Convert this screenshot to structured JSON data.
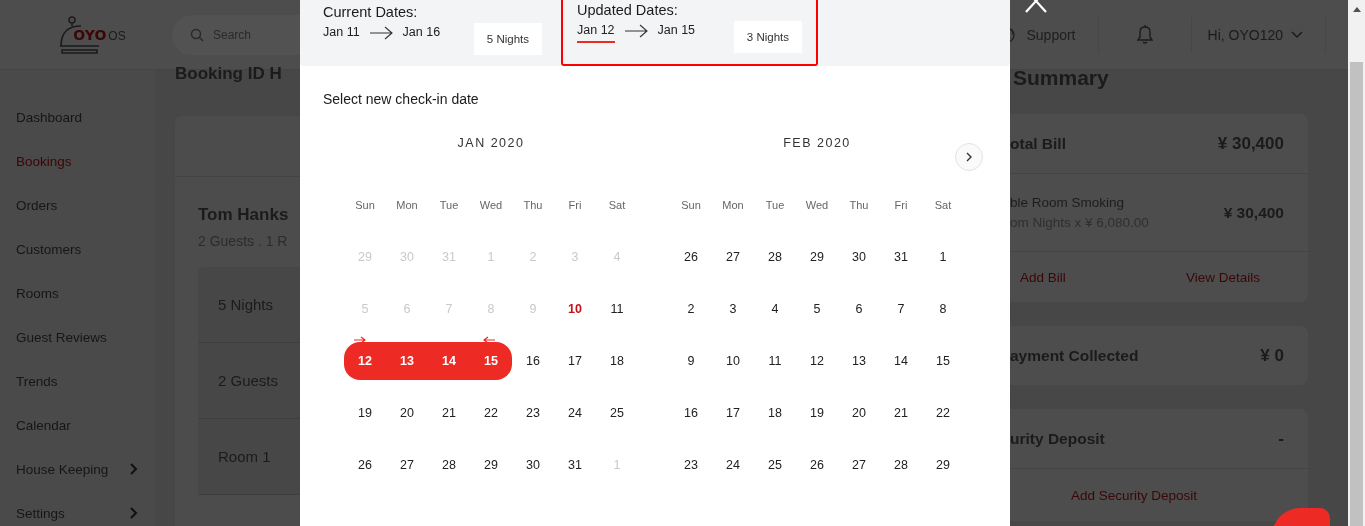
{
  "header": {
    "logo": {
      "brand": "OYO",
      "suffix": "OS"
    },
    "search": {
      "placeholder": "Search"
    },
    "support": "Support",
    "user": "Hi, OYO120"
  },
  "sidebar": {
    "items": [
      {
        "label": "Dashboard",
        "selected": false,
        "expandable": false
      },
      {
        "label": "Bookings",
        "selected": true,
        "expandable": false
      },
      {
        "label": "Orders",
        "selected": false,
        "expandable": false
      },
      {
        "label": "Customers",
        "selected": false,
        "expandable": false
      },
      {
        "label": "Rooms",
        "selected": false,
        "expandable": false
      },
      {
        "label": "Guest Reviews",
        "selected": false,
        "expandable": false
      },
      {
        "label": "Trends",
        "selected": false,
        "expandable": false
      },
      {
        "label": "Calendar",
        "selected": false,
        "expandable": false
      },
      {
        "label": "House Keeping",
        "selected": false,
        "expandable": true
      },
      {
        "label": "Settings",
        "selected": false,
        "expandable": true
      }
    ]
  },
  "booking": {
    "title": "Booking ID H",
    "guest_name": "Tom Hanks",
    "guest_summary": "2 Guests . 1 R",
    "details": [
      "5 Nights",
      "2 Guests",
      "Room 1"
    ]
  },
  "summary": {
    "title": "Summary",
    "total_label": "otal Bill",
    "total_value": "¥ 30,400",
    "item_name": "ble Room Smoking",
    "item_detail": "om Nights x ¥ 6,080.00",
    "item_value": "¥ 30,400",
    "links": [
      "Add Bill",
      "View Details"
    ],
    "payment_label": "ayment Collected",
    "payment_value": "¥ 0",
    "deposit_label": "urity Deposit",
    "deposit_value": "-",
    "deposit_link": "Add Security Deposit"
  },
  "modal": {
    "current": {
      "title": "Current Dates:",
      "from": {
        "text": "Jan 11",
        "selected": false
      },
      "to": {
        "text": "Jan 16",
        "selected": false
      },
      "nights": "5 Nights",
      "highlighted": false
    },
    "updated": {
      "title": "Updated Dates:",
      "from": {
        "text": "Jan 12",
        "selected": true
      },
      "to": {
        "text": "Jan 15",
        "selected": false
      },
      "nights": "3 Nights",
      "highlighted": true
    },
    "prompt": "Select new check-in date",
    "months": [
      {
        "title": "JAN 2020",
        "weekdays": [
          "Sun",
          "Mon",
          "Tue",
          "Wed",
          "Thu",
          "Fri",
          "Sat"
        ],
        "weeks": [
          [
            {
              "day": "29",
              "kind": "disabled",
              "selected": false
            },
            {
              "day": "30",
              "kind": "disabled",
              "selected": false
            },
            {
              "day": "31",
              "kind": "disabled",
              "selected": false
            },
            {
              "day": "1",
              "kind": "disabled",
              "selected": false
            },
            {
              "day": "2",
              "kind": "disabled",
              "selected": false
            },
            {
              "day": "3",
              "kind": "disabled",
              "selected": false
            },
            {
              "day": "4",
              "kind": "disabled",
              "selected": false
            }
          ],
          [
            {
              "day": "5",
              "kind": "disabled",
              "selected": false
            },
            {
              "day": "6",
              "kind": "disabled",
              "selected": false
            },
            {
              "day": "7",
              "kind": "disabled",
              "selected": false
            },
            {
              "day": "8",
              "kind": "disabled",
              "selected": false
            },
            {
              "day": "9",
              "kind": "disabled",
              "selected": false
            },
            {
              "day": "10",
              "kind": "today",
              "selected": false
            },
            {
              "day": "11",
              "kind": "normal",
              "selected": false
            }
          ],
          [
            {
              "day": "12",
              "kind": "normal",
              "selected": true
            },
            {
              "day": "13",
              "kind": "normal",
              "selected": true
            },
            {
              "day": "14",
              "kind": "normal",
              "selected": true
            },
            {
              "day": "15",
              "kind": "normal",
              "selected": true
            },
            {
              "day": "16",
              "kind": "normal",
              "selected": false
            },
            {
              "day": "17",
              "kind": "normal",
              "selected": false
            },
            {
              "day": "18",
              "kind": "normal",
              "selected": false
            }
          ],
          [
            {
              "day": "19",
              "kind": "normal",
              "selected": false
            },
            {
              "day": "20",
              "kind": "normal",
              "selected": false
            },
            {
              "day": "21",
              "kind": "normal",
              "selected": false
            },
            {
              "day": "22",
              "kind": "normal",
              "selected": false
            },
            {
              "day": "23",
              "kind": "normal",
              "selected": false
            },
            {
              "day": "24",
              "kind": "normal",
              "selected": false
            },
            {
              "day": "25",
              "kind": "normal",
              "selected": false
            }
          ],
          [
            {
              "day": "26",
              "kind": "normal",
              "selected": false
            },
            {
              "day": "27",
              "kind": "normal",
              "selected": false
            },
            {
              "day": "28",
              "kind": "normal",
              "selected": false
            },
            {
              "day": "29",
              "kind": "normal",
              "selected": false
            },
            {
              "day": "30",
              "kind": "normal",
              "selected": false
            },
            {
              "day": "31",
              "kind": "normal",
              "selected": false
            },
            {
              "day": "1",
              "kind": "disabled",
              "selected": false
            }
          ]
        ]
      },
      {
        "title": "FEB 2020",
        "weekdays": [
          "Sun",
          "Mon",
          "Tue",
          "Wed",
          "Thu",
          "Fri",
          "Sat"
        ],
        "weeks": [
          [
            {
              "day": "26",
              "kind": "normal",
              "selected": false
            },
            {
              "day": "27",
              "kind": "normal",
              "selected": false
            },
            {
              "day": "28",
              "kind": "normal",
              "selected": false
            },
            {
              "day": "29",
              "kind": "normal",
              "selected": false
            },
            {
              "day": "30",
              "kind": "normal",
              "selected": false
            },
            {
              "day": "31",
              "kind": "normal",
              "selected": false
            },
            {
              "day": "1",
              "kind": "normal",
              "selected": false
            }
          ],
          [
            {
              "day": "2",
              "kind": "normal",
              "selected": false
            },
            {
              "day": "3",
              "kind": "normal",
              "selected": false
            },
            {
              "day": "4",
              "kind": "normal",
              "selected": false
            },
            {
              "day": "5",
              "kind": "normal",
              "selected": false
            },
            {
              "day": "6",
              "kind": "normal",
              "selected": false
            },
            {
              "day": "7",
              "kind": "normal",
              "selected": false
            },
            {
              "day": "8",
              "kind": "normal",
              "selected": false
            }
          ],
          [
            {
              "day": "9",
              "kind": "normal",
              "selected": false
            },
            {
              "day": "10",
              "kind": "normal",
              "selected": false
            },
            {
              "day": "11",
              "kind": "normal",
              "selected": false
            },
            {
              "day": "12",
              "kind": "normal",
              "selected": false
            },
            {
              "day": "13",
              "kind": "normal",
              "selected": false
            },
            {
              "day": "14",
              "kind": "normal",
              "selected": false
            },
            {
              "day": "15",
              "kind": "normal",
              "selected": false
            }
          ],
          [
            {
              "day": "16",
              "kind": "normal",
              "selected": false
            },
            {
              "day": "17",
              "kind": "normal",
              "selected": false
            },
            {
              "day": "18",
              "kind": "normal",
              "selected": false
            },
            {
              "day": "19",
              "kind": "normal",
              "selected": false
            },
            {
              "day": "20",
              "kind": "normal",
              "selected": false
            },
            {
              "day": "21",
              "kind": "normal",
              "selected": false
            },
            {
              "day": "22",
              "kind": "normal",
              "selected": false
            }
          ],
          [
            {
              "day": "23",
              "kind": "normal",
              "selected": false
            },
            {
              "day": "24",
              "kind": "normal",
              "selected": false
            },
            {
              "day": "25",
              "kind": "normal",
              "selected": false
            },
            {
              "day": "26",
              "kind": "normal",
              "selected": false
            },
            {
              "day": "27",
              "kind": "normal",
              "selected": false
            },
            {
              "day": "28",
              "kind": "normal",
              "selected": false
            },
            {
              "day": "29",
              "kind": "normal",
              "selected": false
            }
          ]
        ]
      }
    ]
  }
}
